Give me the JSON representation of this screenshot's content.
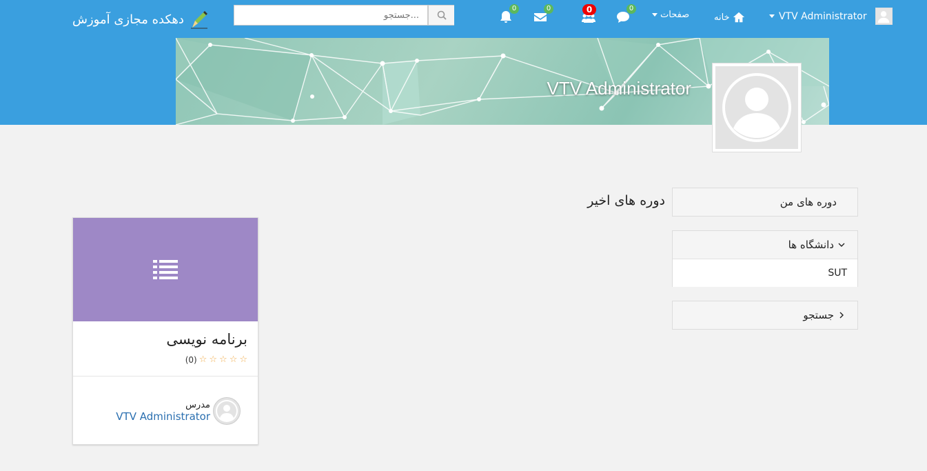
{
  "header": {
    "site_title": "دهکده مجازی آموزش",
    "search_placeholder": "جستجو...",
    "notifications_count": "0",
    "messages_count": "0",
    "friends_count": "0",
    "chat_count": "0",
    "pages_label": "صفحات",
    "home_label": "خانه",
    "user_name": "VTV Administrator"
  },
  "profile": {
    "name": "VTV Administrator"
  },
  "sidebar": {
    "my_courses": "دوره های من",
    "universities": "دانشگاه ها",
    "universities_items": [
      "SUT"
    ],
    "search": "جستجو"
  },
  "main": {
    "section_title": "دوره های اخیر",
    "course": {
      "title": "برنامه نویسی",
      "rating_count": "(0)",
      "teacher_role": "مدرس",
      "teacher_name": "VTV Administrator"
    }
  },
  "colors": {
    "topbar": "#3a9fdf",
    "card_header": "#9e88c6",
    "badge_green": "#5cb85c",
    "badge_red": "#e00000"
  }
}
